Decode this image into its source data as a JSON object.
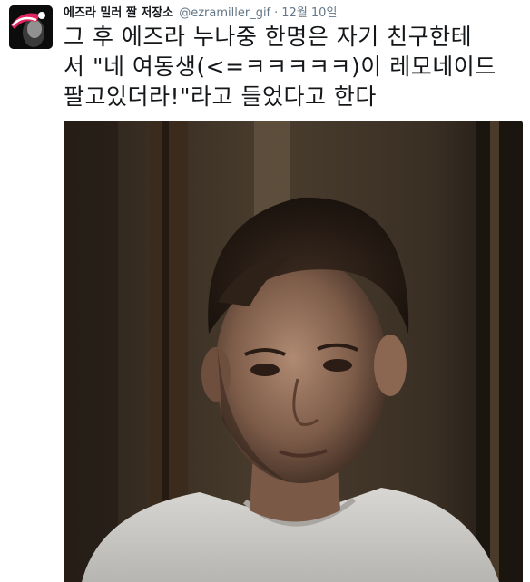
{
  "tweet": {
    "display_name": "에즈라 밀러 짤 저장소",
    "handle": "@ezramiller_gif",
    "separator": "·",
    "date": "12월 10일",
    "text": "그 후 에즈라 누나중 한명은 자기 친구한테\n서 \"네 여동생(<=ㅋㅋㅋㅋㅋ)이 레모네이드\n팔고있더라!\"라고 들었다고 한다",
    "avatar_icon": "profile-avatar",
    "media_description_icon": "photo-image"
  },
  "colors": {
    "text": "#14171a",
    "secondary": "#657786",
    "avatar_accent": "#e0245e"
  }
}
